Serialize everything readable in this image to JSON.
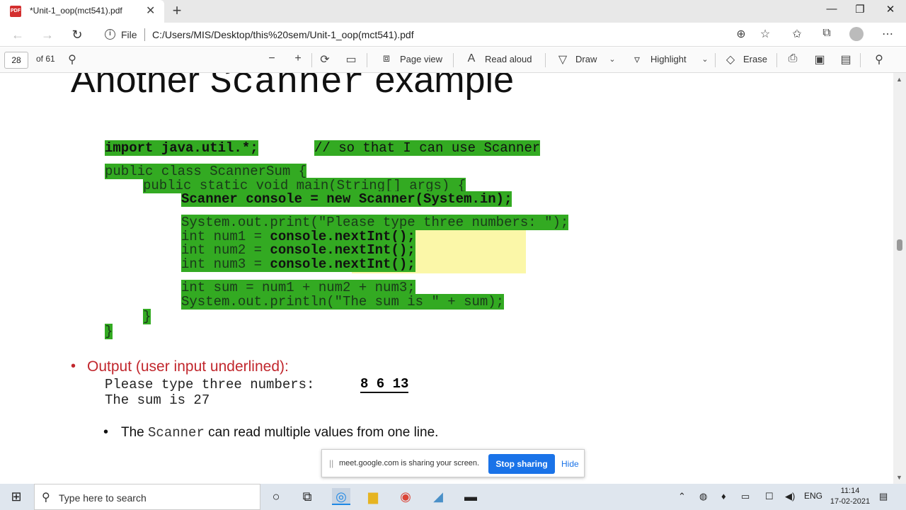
{
  "browser": {
    "tab_title": "*Unit-1_oop(mct541).pdf",
    "tab_icon_label": "PDF",
    "file_label": "File",
    "url": "C:/Users/MIS/Desktop/this%20sem/Unit-1_oop(mct541).pdf"
  },
  "pdf_toolbar": {
    "page_number": "28",
    "page_total": "of 61",
    "page_view": "Page view",
    "read_aloud": "Read aloud",
    "draw": "Draw",
    "highlight": "Highlight",
    "erase": "Erase"
  },
  "slide": {
    "title_pre": "Another ",
    "title_mono": "Scanner",
    "title_post": " example",
    "code": {
      "import_kw": "import java.util.*;",
      "import_comment": "// so that I can use Scanner",
      "class_line": "public class ScannerSum {",
      "main_line": "public static void main(String[] args) {",
      "scanner_line": "Scanner console = new Scanner(System.in);",
      "print_a": "System.out.print",
      "print_b": "(\"Please type three numbers: \");",
      "int1_a": "int num1 = ",
      "int1_b": "console.nextInt",
      "int1_c": "();",
      "int2_a": "int num2 = ",
      "int2_b": "console.nextInt",
      "int2_c": "();",
      "int3_a": "int num3 = ",
      "int3_b": "console.nextInt",
      "int3_c": "();",
      "sum_line": "int sum = num1 + num2 + num3;",
      "println_a": "System.out.println",
      "println_b": "(\"The sum is \" + sum);",
      "close_inner": "}",
      "close_outer": "}"
    },
    "output_heading": "Output (user input underlined):",
    "output_line1": "Please type three numbers: ",
    "output_input": "8 6 13",
    "output_line2": "The sum is 27",
    "note_pre": "The ",
    "note_mono": "Scanner",
    "note_post": " can read multiple values from one line."
  },
  "share_banner": {
    "message": "meet.google.com is sharing your screen.",
    "stop": "Stop sharing",
    "hide": "Hide"
  },
  "taskbar": {
    "search_placeholder": "Type here to search",
    "language": "ENG",
    "time": "11:14",
    "date": "17-02-2021"
  },
  "colors": {
    "highlight_green": "#33aa22",
    "highlight_yellow": "#fbf7a8",
    "output_red": "#c1272d",
    "stop_button": "#1a73e8"
  }
}
